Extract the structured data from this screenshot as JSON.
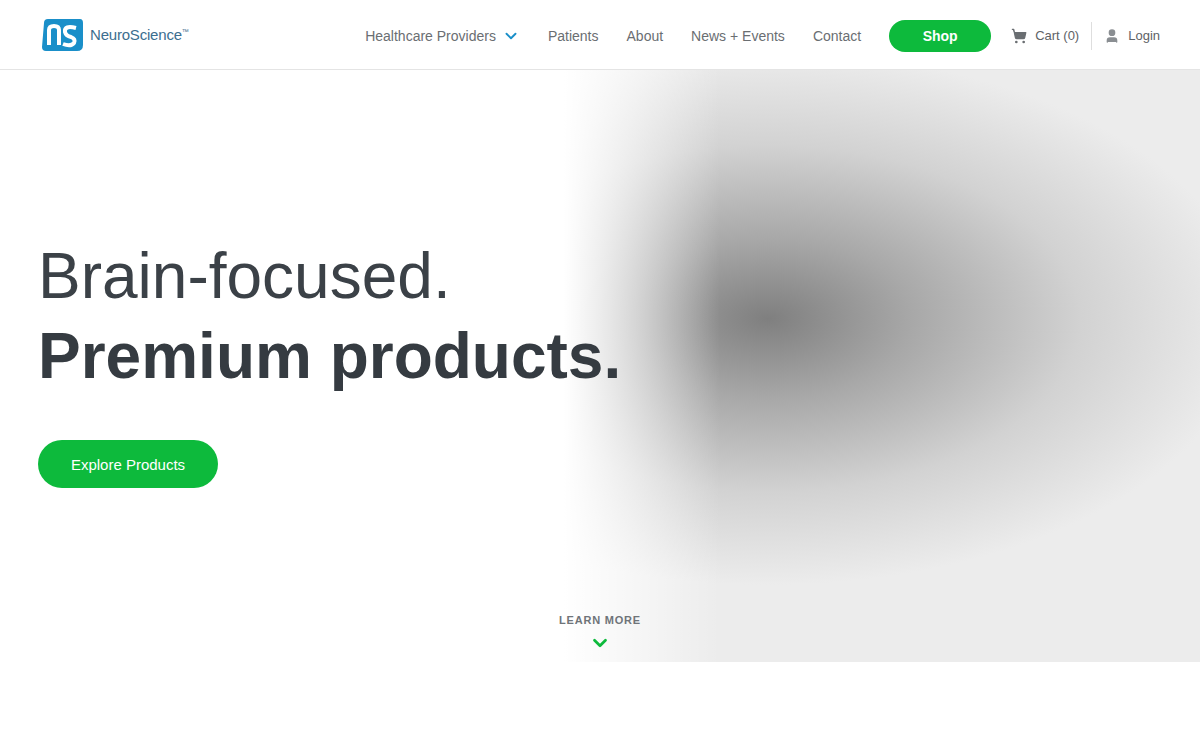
{
  "header": {
    "logo": {
      "name": "NeuroScience",
      "mark": "™"
    },
    "nav": [
      {
        "label": "Healthcare Providers",
        "has_dropdown": true
      },
      {
        "label": "Patients",
        "has_dropdown": false
      },
      {
        "label": "About",
        "has_dropdown": false
      },
      {
        "label": "News + Events",
        "has_dropdown": false
      },
      {
        "label": "Contact",
        "has_dropdown": false
      }
    ],
    "shop_button": "Shop",
    "cart": {
      "label": "Cart (0)"
    },
    "login": "Login"
  },
  "hero": {
    "title_light": "Brain-focused.",
    "title_bold": "Premium products.",
    "button": "Explore Products",
    "learn_more": "LEARN MORE"
  }
}
